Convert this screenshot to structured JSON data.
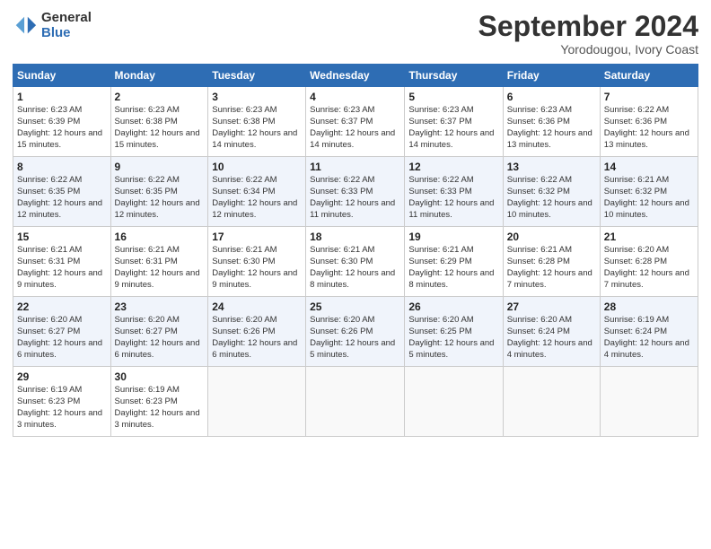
{
  "header": {
    "logo_general": "General",
    "logo_blue": "Blue",
    "month": "September 2024",
    "location": "Yorodougou, Ivory Coast"
  },
  "days_of_week": [
    "Sunday",
    "Monday",
    "Tuesday",
    "Wednesday",
    "Thursday",
    "Friday",
    "Saturday"
  ],
  "weeks": [
    [
      {
        "day": "1",
        "sunrise": "6:23 AM",
        "sunset": "6:39 PM",
        "daylight": "12 hours and 15 minutes."
      },
      {
        "day": "2",
        "sunrise": "6:23 AM",
        "sunset": "6:38 PM",
        "daylight": "12 hours and 15 minutes."
      },
      {
        "day": "3",
        "sunrise": "6:23 AM",
        "sunset": "6:38 PM",
        "daylight": "12 hours and 14 minutes."
      },
      {
        "day": "4",
        "sunrise": "6:23 AM",
        "sunset": "6:37 PM",
        "daylight": "12 hours and 14 minutes."
      },
      {
        "day": "5",
        "sunrise": "6:23 AM",
        "sunset": "6:37 PM",
        "daylight": "12 hours and 14 minutes."
      },
      {
        "day": "6",
        "sunrise": "6:23 AM",
        "sunset": "6:36 PM",
        "daylight": "12 hours and 13 minutes."
      },
      {
        "day": "7",
        "sunrise": "6:22 AM",
        "sunset": "6:36 PM",
        "daylight": "12 hours and 13 minutes."
      }
    ],
    [
      {
        "day": "8",
        "sunrise": "6:22 AM",
        "sunset": "6:35 PM",
        "daylight": "12 hours and 12 minutes."
      },
      {
        "day": "9",
        "sunrise": "6:22 AM",
        "sunset": "6:35 PM",
        "daylight": "12 hours and 12 minutes."
      },
      {
        "day": "10",
        "sunrise": "6:22 AM",
        "sunset": "6:34 PM",
        "daylight": "12 hours and 12 minutes."
      },
      {
        "day": "11",
        "sunrise": "6:22 AM",
        "sunset": "6:33 PM",
        "daylight": "12 hours and 11 minutes."
      },
      {
        "day": "12",
        "sunrise": "6:22 AM",
        "sunset": "6:33 PM",
        "daylight": "12 hours and 11 minutes."
      },
      {
        "day": "13",
        "sunrise": "6:22 AM",
        "sunset": "6:32 PM",
        "daylight": "12 hours and 10 minutes."
      },
      {
        "day": "14",
        "sunrise": "6:21 AM",
        "sunset": "6:32 PM",
        "daylight": "12 hours and 10 minutes."
      }
    ],
    [
      {
        "day": "15",
        "sunrise": "6:21 AM",
        "sunset": "6:31 PM",
        "daylight": "12 hours and 9 minutes."
      },
      {
        "day": "16",
        "sunrise": "6:21 AM",
        "sunset": "6:31 PM",
        "daylight": "12 hours and 9 minutes."
      },
      {
        "day": "17",
        "sunrise": "6:21 AM",
        "sunset": "6:30 PM",
        "daylight": "12 hours and 9 minutes."
      },
      {
        "day": "18",
        "sunrise": "6:21 AM",
        "sunset": "6:30 PM",
        "daylight": "12 hours and 8 minutes."
      },
      {
        "day": "19",
        "sunrise": "6:21 AM",
        "sunset": "6:29 PM",
        "daylight": "12 hours and 8 minutes."
      },
      {
        "day": "20",
        "sunrise": "6:21 AM",
        "sunset": "6:28 PM",
        "daylight": "12 hours and 7 minutes."
      },
      {
        "day": "21",
        "sunrise": "6:20 AM",
        "sunset": "6:28 PM",
        "daylight": "12 hours and 7 minutes."
      }
    ],
    [
      {
        "day": "22",
        "sunrise": "6:20 AM",
        "sunset": "6:27 PM",
        "daylight": "12 hours and 6 minutes."
      },
      {
        "day": "23",
        "sunrise": "6:20 AM",
        "sunset": "6:27 PM",
        "daylight": "12 hours and 6 minutes."
      },
      {
        "day": "24",
        "sunrise": "6:20 AM",
        "sunset": "6:26 PM",
        "daylight": "12 hours and 6 minutes."
      },
      {
        "day": "25",
        "sunrise": "6:20 AM",
        "sunset": "6:26 PM",
        "daylight": "12 hours and 5 minutes."
      },
      {
        "day": "26",
        "sunrise": "6:20 AM",
        "sunset": "6:25 PM",
        "daylight": "12 hours and 5 minutes."
      },
      {
        "day": "27",
        "sunrise": "6:20 AM",
        "sunset": "6:24 PM",
        "daylight": "12 hours and 4 minutes."
      },
      {
        "day": "28",
        "sunrise": "6:19 AM",
        "sunset": "6:24 PM",
        "daylight": "12 hours and 4 minutes."
      }
    ],
    [
      {
        "day": "29",
        "sunrise": "6:19 AM",
        "sunset": "6:23 PM",
        "daylight": "12 hours and 3 minutes."
      },
      {
        "day": "30",
        "sunrise": "6:19 AM",
        "sunset": "6:23 PM",
        "daylight": "12 hours and 3 minutes."
      },
      null,
      null,
      null,
      null,
      null
    ]
  ]
}
